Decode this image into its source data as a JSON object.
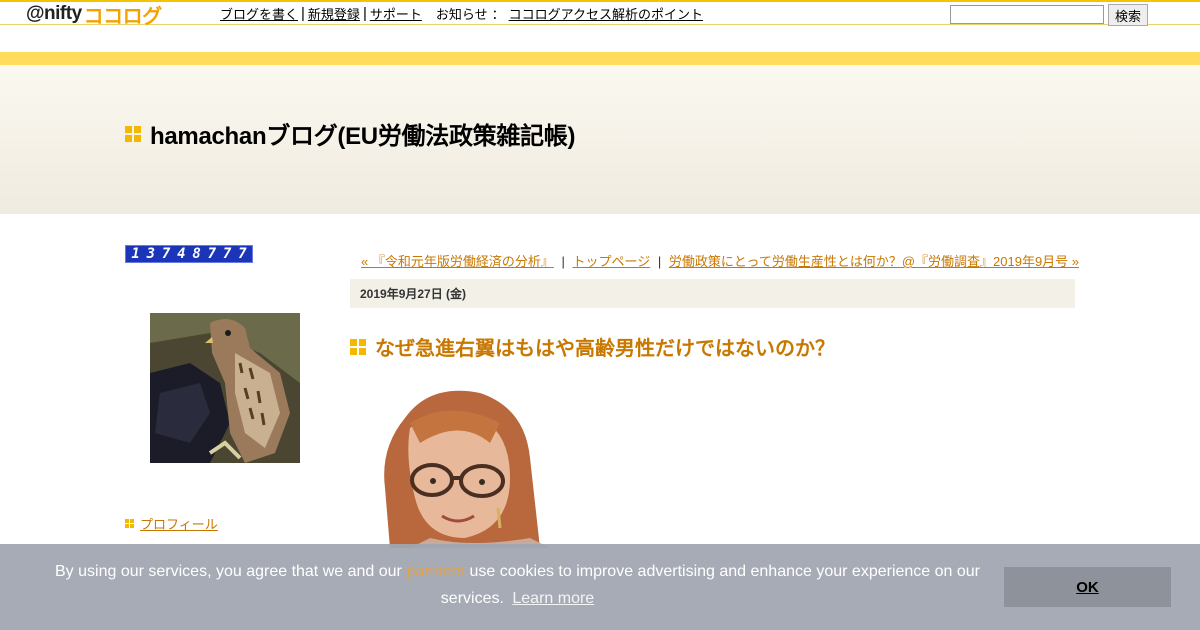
{
  "topbar": {
    "logo_at": "@nifty",
    "logo_brand": "ココログ",
    "nav": [
      {
        "label": "ブログを書く"
      },
      {
        "label": "新規登録"
      },
      {
        "label": "サポート"
      }
    ],
    "news_label": "お知らせ",
    "news_link": "ココログアクセス解析のポイント",
    "search_value": "",
    "search_button": "検索"
  },
  "header": {
    "blog_title": "hamachanブログ(EU労働法政策雑記帳)"
  },
  "sidebar": {
    "counter_digits": [
      "1",
      "3",
      "7",
      "4",
      "8",
      "7",
      "7",
      "7"
    ],
    "profile_link": "プロフィール"
  },
  "post_nav": {
    "prev": "« 『令和元年版労働経済の分析』",
    "separator": "|",
    "home": "トップページ",
    "next": "労働政策にとって労働生産性とは何か？@『労働調査』2019年9月号 »"
  },
  "entry": {
    "date": "2019年9月27日 (金)",
    "title": "なぜ急進右翼はもはや高齢男性だけではないのか？"
  },
  "cookie_banner": {
    "text_before": "By using our services, you agree that we and our",
    "partners_link": "partners",
    "text_after": "use cookies to improve advertising and enhance your experience on our services.",
    "learn_more": "Learn more",
    "ok_button": "OK"
  },
  "colors": {
    "accent_orange": "#c87800",
    "square_yellow": "#f5b800",
    "stripe_yellow": "#ffdc5c",
    "counter_blue": "#1a35b8"
  }
}
